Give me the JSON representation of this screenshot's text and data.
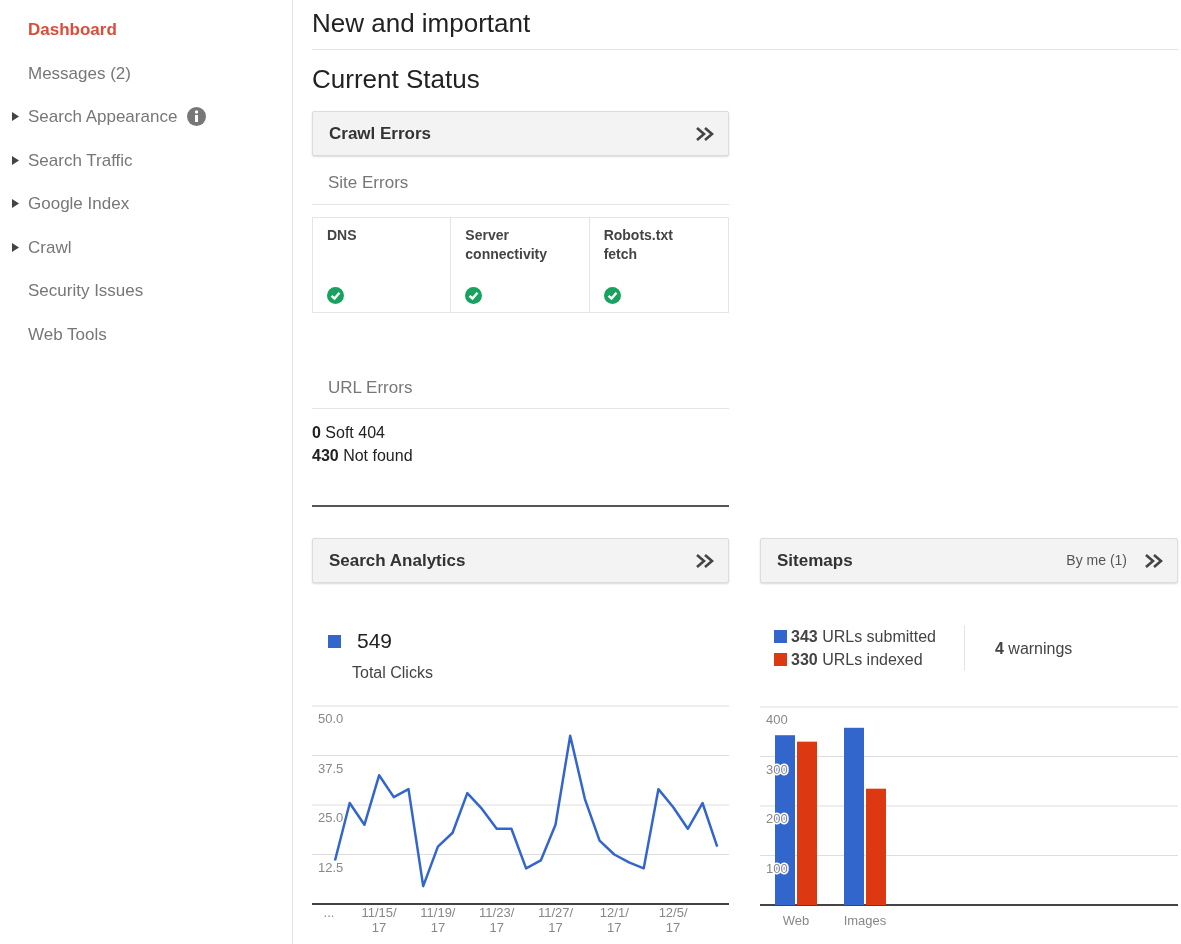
{
  "sidebar": {
    "items": [
      {
        "label": "Dashboard",
        "selected": true
      },
      {
        "label": "Messages (2)",
        "selected": false
      },
      {
        "label": "Search Appearance",
        "selected": false,
        "expanded": false,
        "info": true
      },
      {
        "label": "Search Traffic",
        "selected": false,
        "expanded": false
      },
      {
        "label": "Google Index",
        "selected": false,
        "expanded": false
      },
      {
        "label": "Crawl",
        "selected": false,
        "expanded": false
      },
      {
        "label": "Security Issues",
        "selected": false
      },
      {
        "label": "Web Tools",
        "selected": false
      }
    ]
  },
  "page_title": "New and important",
  "section_title": "Current Status",
  "crawl_errors": {
    "title": "Crawl Errors",
    "site_errors_label": "Site Errors",
    "site_errors": [
      {
        "label": "DNS",
        "ok": true
      },
      {
        "label": "Server connectivity",
        "ok": true
      },
      {
        "label": "Robots.txt fetch",
        "ok": true
      }
    ],
    "url_errors_label": "URL Errors",
    "url_errors": [
      "**0** Soft 404",
      "**430** Not found"
    ]
  },
  "search_analytics": {
    "title": "Search Analytics",
    "total": "549",
    "total_label": "Total Clicks",
    "chart_data": {
      "type": "line",
      "grid": true,
      "categories": [
        "...",
        null,
        null,
        "11/15/ 17",
        null,
        null,
        null,
        "11/19/ 17",
        null,
        null,
        null,
        "11/23/ 17",
        null,
        null,
        null,
        "11/27/ 17",
        null,
        null,
        null,
        "12/1/ 17",
        null,
        null,
        null,
        "12/5/ 17",
        null,
        null,
        null
      ],
      "series": [
        {
          "color": "#3366cc",
          "values": [
            11,
            25.5,
            20,
            32.5,
            27,
            29,
            4.5,
            14.5,
            18,
            28,
            24,
            19,
            19,
            9,
            11,
            20,
            42.5,
            26.5,
            16,
            12.5,
            10.5,
            9,
            29,
            24.5,
            19,
            25.5,
            14.5
          ]
        }
      ],
      "ylim": [
        0,
        50
      ],
      "yticks": [
        {
          "value": 12.5,
          "label": "12.5"
        },
        {
          "value": 25,
          "label": "25.0"
        },
        {
          "value": 37.5,
          "label": "37.5"
        },
        {
          "value": 50,
          "label": "50.0"
        }
      ]
    }
  },
  "sitemaps": {
    "title": "Sitemaps",
    "filter": "By me (1)",
    "legend": [
      {
        "text": "**343** URLs submitted",
        "color": "#3366cc"
      },
      {
        "text": "**330** URLs indexed",
        "color": "#dc3912"
      }
    ],
    "warnings": "**4** warnings",
    "chart_data": {
      "type": "bar",
      "grid": true,
      "categories": [
        "Web",
        "Images"
      ],
      "series": [
        {
          "color": "#3366cc",
          "values": [
            343,
            358
          ]
        },
        {
          "color": "#dc3912",
          "values": [
            330,
            235
          ]
        }
      ],
      "ylim": [
        0,
        400
      ],
      "yticks": [
        100,
        200,
        300,
        400
      ]
    }
  }
}
